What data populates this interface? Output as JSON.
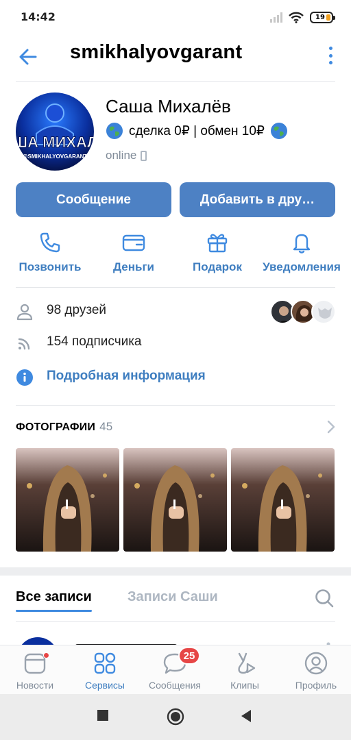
{
  "status_bar": {
    "time": "14:42",
    "battery": "19"
  },
  "header": {
    "title": "smikhalyovgarant"
  },
  "profile": {
    "name": "Саша Михалёв",
    "status": "сделка 0₽ | обмен 10₽",
    "online": "online",
    "avatar_text": "САША МИХАЛЁВ",
    "avatar_handle": "@SMIKHALYOVGARANT"
  },
  "buttons": {
    "message": "Сообщение",
    "add_friend": "Добавить в дру…"
  },
  "actions": [
    {
      "label": "Позвонить",
      "icon": "phone-icon"
    },
    {
      "label": "Деньги",
      "icon": "money-icon"
    },
    {
      "label": "Подарок",
      "icon": "gift-icon"
    },
    {
      "label": "Уведомления",
      "icon": "bell-icon"
    }
  ],
  "info": {
    "friends": "98 друзей",
    "followers": "154 подписчика",
    "details_link": "Подробная информация"
  },
  "photos": {
    "title": "ФОТОГРАФИИ",
    "count": "45"
  },
  "tabs": {
    "all_posts": "Все записи",
    "owner_posts": "Записи Саши"
  },
  "bottom_nav": [
    {
      "label": "Новости",
      "icon": "news-icon"
    },
    {
      "label": "Сервисы",
      "icon": "services-icon",
      "active": true
    },
    {
      "label": "Сообщения",
      "icon": "messages-icon",
      "badge": "25"
    },
    {
      "label": "Клипы",
      "icon": "clips-icon"
    },
    {
      "label": "Профиль",
      "icon": "profile-icon"
    }
  ],
  "colors": {
    "accent": "#3f8ae0",
    "button": "#4d81c4",
    "link": "#3f7ec0",
    "badge": "#e64646",
    "secondary_text": "#818c99"
  }
}
